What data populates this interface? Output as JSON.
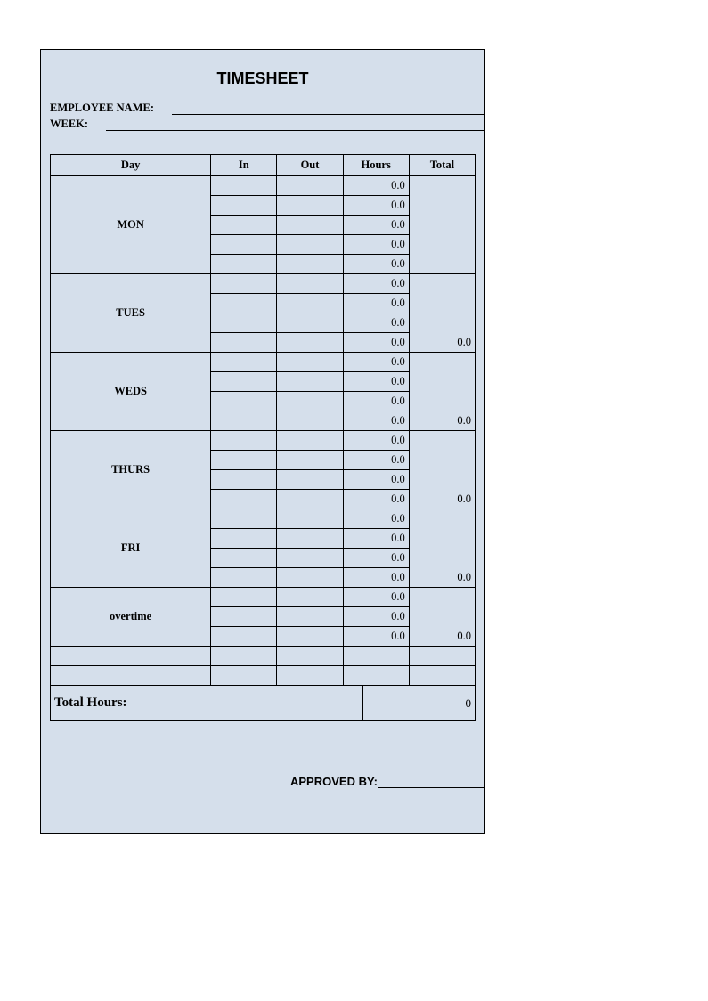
{
  "title": "TIMESHEET",
  "meta": {
    "employee_label": "EMPLOYEE NAME:",
    "week_label": "WEEK:"
  },
  "headers": {
    "day": "Day",
    "in": "In",
    "out": "Out",
    "hours": "Hours",
    "total": "Total"
  },
  "days": [
    {
      "name": "MON",
      "hours": [
        "0.0",
        "0.0",
        "0.0",
        "0.0",
        "0.0"
      ],
      "total": ""
    },
    {
      "name": "TUES",
      "hours": [
        "0.0",
        "0.0",
        "0.0",
        "0.0"
      ],
      "total": "0.0"
    },
    {
      "name": "WEDS",
      "hours": [
        "0.0",
        "0.0",
        "0.0",
        "0.0"
      ],
      "total": "0.0"
    },
    {
      "name": "THURS",
      "hours": [
        "0.0",
        "0.0",
        "0.0",
        "0.0"
      ],
      "total": "0.0"
    },
    {
      "name": "FRI",
      "hours": [
        "0.0",
        "0.0",
        "0.0",
        "0.0"
      ],
      "total": "0.0"
    },
    {
      "name": "overtime",
      "hours": [
        "0.0",
        "0.0",
        "0.0"
      ],
      "total": "0.0"
    }
  ],
  "blank_rows": 2,
  "totals": {
    "label": "Total Hours:",
    "value": "0"
  },
  "approved_label": "APPROVED BY:"
}
